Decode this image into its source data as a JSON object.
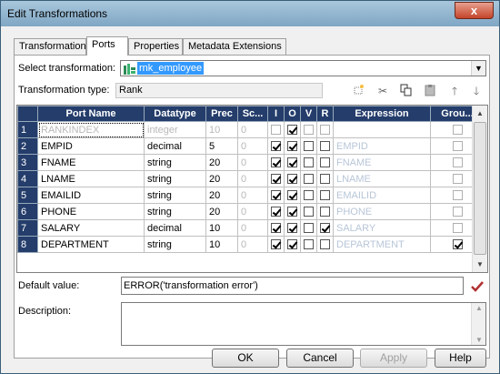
{
  "window": {
    "title": "Edit Transformations",
    "close_label": "x"
  },
  "tabs": [
    {
      "label": "Transformation"
    },
    {
      "label": "Ports"
    },
    {
      "label": "Properties"
    },
    {
      "label": "Metadata Extensions"
    }
  ],
  "select_transformation": {
    "label": "Select transformation:",
    "value": "rnk_employee"
  },
  "transformation_type": {
    "label": "Transformation type:",
    "value": "Rank"
  },
  "toolbar": {
    "icons": [
      "new-port-icon",
      "cut-icon",
      "copy-icon",
      "paste-icon",
      "move-up-icon",
      "move-down-icon"
    ]
  },
  "ports_grid": {
    "columns": [
      "Port Name",
      "Datatype",
      "Prec",
      "Sc...",
      "I",
      "O",
      "V",
      "R",
      "Expression",
      "Grou..."
    ],
    "rows": [
      {
        "num": "1",
        "name": "RANKINDEX",
        "datatype": "integer",
        "prec": "10",
        "scale": "0",
        "i": false,
        "o": true,
        "v": false,
        "r": false,
        "expression": "",
        "group": false,
        "disabled": true
      },
      {
        "num": "2",
        "name": "EMPID",
        "datatype": "decimal",
        "prec": "5",
        "scale": "0",
        "i": true,
        "o": true,
        "v": false,
        "r": false,
        "expression": "EMPID",
        "group": false,
        "disabled": false
      },
      {
        "num": "3",
        "name": "FNAME",
        "datatype": "string",
        "prec": "20",
        "scale": "0",
        "i": true,
        "o": true,
        "v": false,
        "r": false,
        "expression": "FNAME",
        "group": false,
        "disabled": false
      },
      {
        "num": "4",
        "name": "LNAME",
        "datatype": "string",
        "prec": "20",
        "scale": "0",
        "i": true,
        "o": true,
        "v": false,
        "r": false,
        "expression": "LNAME",
        "group": false,
        "disabled": false
      },
      {
        "num": "5",
        "name": "EMAILID",
        "datatype": "string",
        "prec": "20",
        "scale": "0",
        "i": true,
        "o": true,
        "v": false,
        "r": false,
        "expression": "EMAILID",
        "group": false,
        "disabled": false
      },
      {
        "num": "6",
        "name": "PHONE",
        "datatype": "string",
        "prec": "20",
        "scale": "0",
        "i": true,
        "o": true,
        "v": false,
        "r": false,
        "expression": "PHONE",
        "group": false,
        "disabled": false
      },
      {
        "num": "7",
        "name": "SALARY",
        "datatype": "decimal",
        "prec": "10",
        "scale": "0",
        "i": true,
        "o": true,
        "v": false,
        "r": true,
        "expression": "SALARY",
        "group": false,
        "disabled": false
      },
      {
        "num": "8",
        "name": "DEPARTMENT",
        "datatype": "string",
        "prec": "10",
        "scale": "0",
        "i": true,
        "o": true,
        "v": false,
        "r": false,
        "expression": "DEPARTMENT",
        "group": true,
        "disabled": false
      }
    ]
  },
  "default_value": {
    "label": "Default value:",
    "value": "ERROR('transformation error')"
  },
  "description": {
    "label": "Description:",
    "value": ""
  },
  "buttons": {
    "ok": "OK",
    "cancel": "Cancel",
    "apply": "Apply",
    "help": "Help"
  },
  "colors": {
    "header_bg": "#243d6b",
    "selection": "#3399ff",
    "check_red": "#c0392b"
  }
}
